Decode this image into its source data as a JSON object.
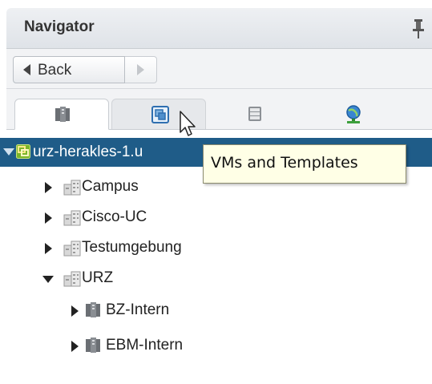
{
  "navigator": {
    "title": "Navigator",
    "pin_icon": "pin-icon"
  },
  "nav": {
    "back_label": "Back",
    "back_icon": "chevron-left-icon",
    "forward_icon": "chevron-right-icon"
  },
  "tabs": [
    {
      "icon": "host-cluster-icon",
      "active": true
    },
    {
      "icon": "vms-templates-icon",
      "hover": true
    },
    {
      "icon": "storage-icon"
    },
    {
      "icon": "networking-icon"
    }
  ],
  "tooltip": {
    "text": "VMs and Templates"
  },
  "tree": {
    "root": {
      "label": "urz-herakles-1.u",
      "icon": "vcenter-icon",
      "expanded": true,
      "selected": true
    },
    "items": [
      {
        "label": "Campus",
        "icon": "datacenter-icon",
        "expanded": false
      },
      {
        "label": "Cisco-UC",
        "icon": "datacenter-icon",
        "expanded": false
      },
      {
        "label": "Testumgebung",
        "icon": "datacenter-icon",
        "expanded": false
      },
      {
        "label": "URZ",
        "icon": "datacenter-icon",
        "expanded": true,
        "children": [
          {
            "label": "BZ-Intern",
            "icon": "cluster-icon",
            "expanded": false
          },
          {
            "label": "EBM-Intern",
            "icon": "cluster-icon",
            "expanded": false
          }
        ]
      }
    ]
  },
  "colors": {
    "selection": "#1f5c88",
    "tooltip_bg": "#ffffe6",
    "header_bg": "#dfe3e8"
  }
}
